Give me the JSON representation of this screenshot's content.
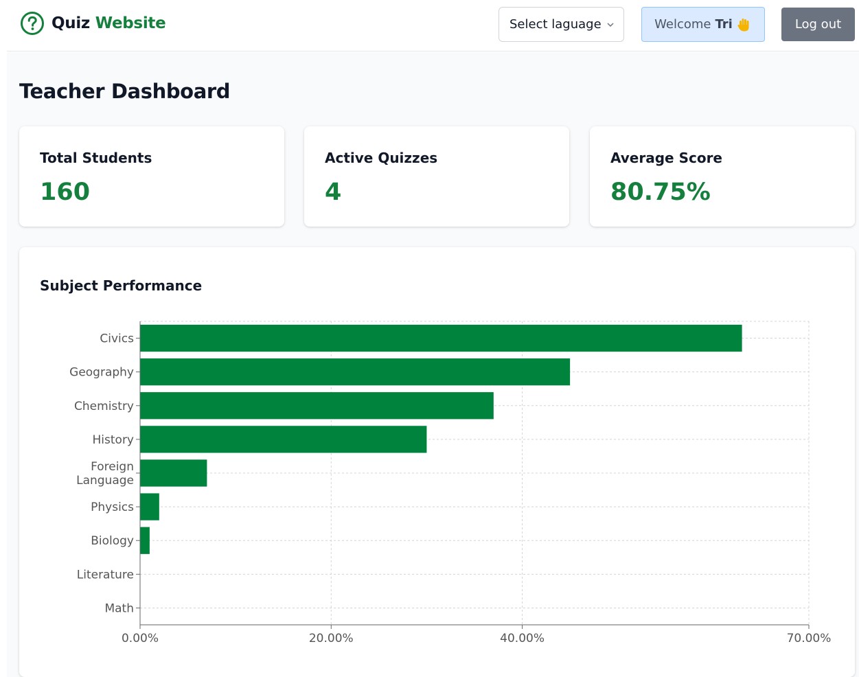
{
  "header": {
    "brand_part1": "Quiz",
    "brand_part2": "Website",
    "brand_icon": "question-circle-icon",
    "language_select": "Select laguage",
    "welcome_prefix": "Welcome",
    "welcome_name": "Tri",
    "welcome_icon": "waving-hand-icon",
    "logout_label": "Log out"
  },
  "page": {
    "title": "Teacher Dashboard"
  },
  "stats": [
    {
      "label": "Total Students",
      "value": "160"
    },
    {
      "label": "Active Quizzes",
      "value": "4"
    },
    {
      "label": "Average Score",
      "value": "80.75%"
    }
  ],
  "colors": {
    "accent": "#15803d",
    "bar": "#00843d",
    "grid": "#d1d5db",
    "welcome_bg": "#dbeafe",
    "logout_bg": "#6b7280"
  },
  "chart_data": {
    "type": "bar",
    "orientation": "horizontal",
    "title": "Subject Performance",
    "categories": [
      "Civics",
      "Geography",
      "Chemistry",
      "History",
      "Foreign Language",
      "Physics",
      "Biology",
      "Literature",
      "Math"
    ],
    "values": [
      63,
      45,
      37,
      30,
      7,
      2,
      1,
      0,
      0
    ],
    "x_ticks": [
      0,
      20,
      40,
      70
    ],
    "x_tick_labels": [
      "0.00%",
      "20.00%",
      "40.00%",
      "70.00%"
    ],
    "xlim": [
      0,
      70
    ],
    "grid": true,
    "legend": "none"
  }
}
